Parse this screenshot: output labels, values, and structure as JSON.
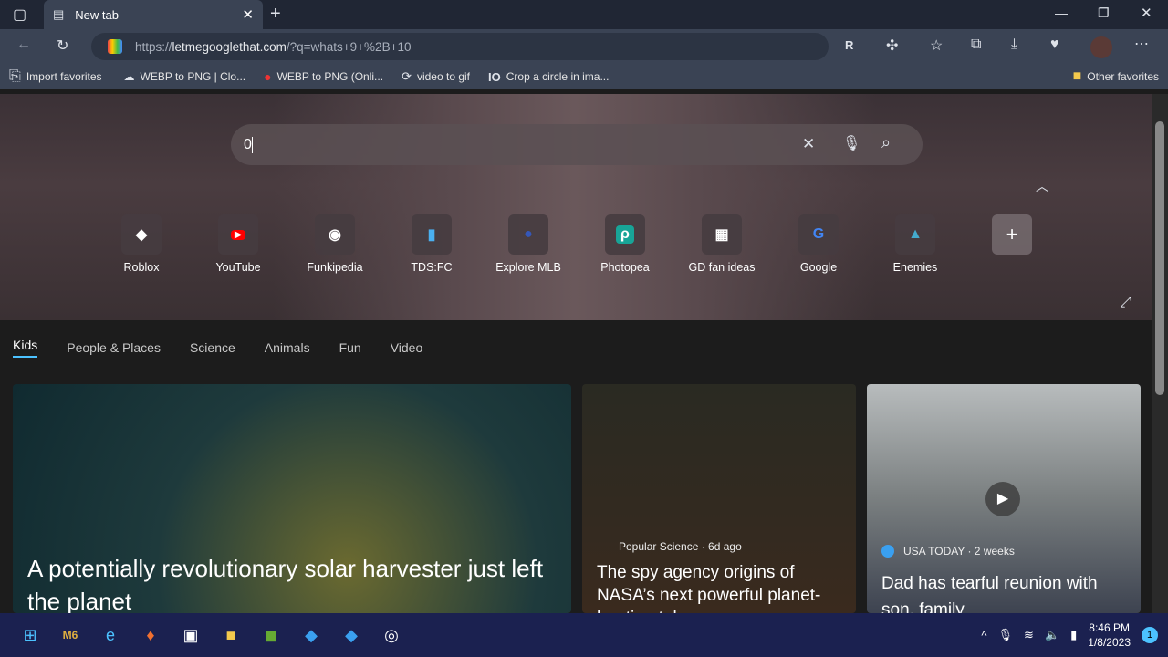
{
  "browser": {
    "tab_title": "New tab",
    "url_prefix": "https://",
    "url_domain": "letmegooglethat.com",
    "url_rest": "/?q=whats+9+%2B+10"
  },
  "bookmarks": [
    "Import favorites",
    "WEBP to PNG | Clo...",
    "WEBP to PNG (Onli...",
    "video to gif",
    "Crop a circle in ima..."
  ],
  "other_favorites": "Other favorites",
  "search": {
    "value": "0"
  },
  "shortcuts": [
    "Roblox",
    "YouTube",
    "Funkipedia",
    "TDS:FC",
    "Explore MLB",
    "Photopea",
    "GD fan ideas",
    "Google",
    "Enemies"
  ],
  "feed_tabs": [
    "Kids",
    "People & Places",
    "Science",
    "Animals",
    "Fun",
    "Video"
  ],
  "cards": [
    {
      "title": "A potentially revolutionary solar harvester just left the planet"
    },
    {
      "source": "Popular Science · 6d ago",
      "title": "The spy agency origins of NASA’s next powerful planet-hunting telescope"
    },
    {
      "source": "USA TODAY · 2 weeks",
      "title": "Dad has tearful reunion with son, family"
    }
  ],
  "taskbar": {
    "time": "8:46 PM",
    "date": "1/8/2023",
    "notifications": "1"
  },
  "colors": {
    "accent": "#4cc2ff",
    "tabbar": "#202634",
    "toolbar": "#3a4354"
  }
}
